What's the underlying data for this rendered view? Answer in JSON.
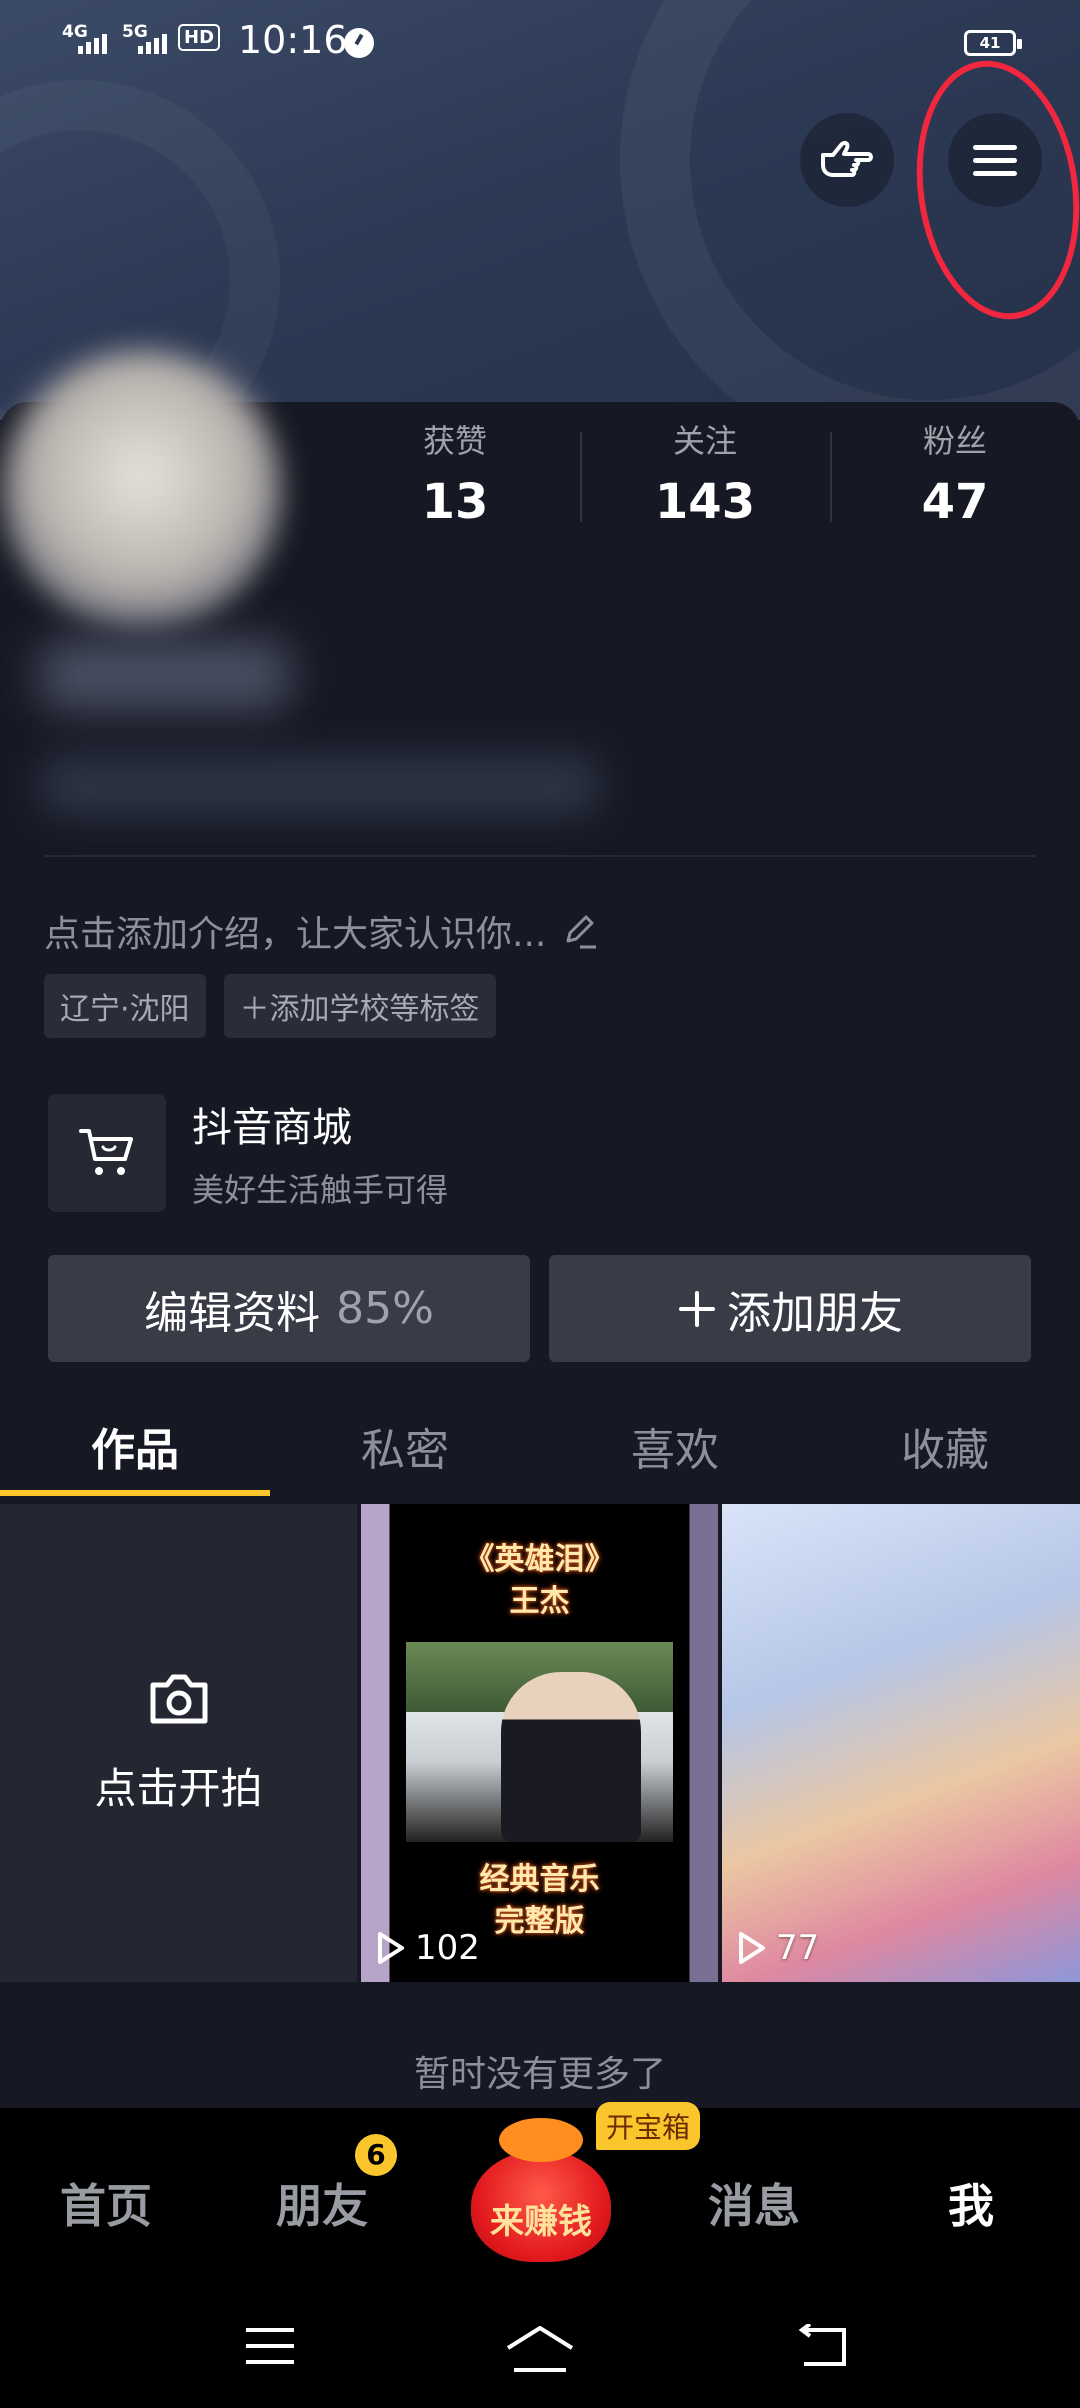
{
  "status_bar": {
    "signal1": "4G",
    "signal2": "5G",
    "hd": "HD",
    "time": "10:16",
    "battery": "41"
  },
  "profile": {
    "stats": [
      {
        "label": "获赞",
        "value": "13"
      },
      {
        "label": "关注",
        "value": "143"
      },
      {
        "label": "粉丝",
        "value": "47"
      }
    ],
    "intro": "点击添加介绍，让大家认识你...",
    "tags": [
      "辽宁·沈阳",
      "＋添加学校等标签"
    ]
  },
  "shop": {
    "title": "抖音商城",
    "subtitle": "美好生活触手可得"
  },
  "actions": {
    "edit_label": "编辑资料",
    "edit_percent": "85%",
    "add_friend_label": "添加朋友"
  },
  "tabs": [
    "作品",
    "私密",
    "喜欢",
    "收藏"
  ],
  "grid": {
    "shoot_label": "点击开拍",
    "videos": [
      {
        "title1": "《英雄泪》",
        "title2": "王杰",
        "caption1": "经典音乐",
        "caption2": "完整版",
        "plays": "102"
      },
      {
        "plays": "77"
      }
    ]
  },
  "no_more": "暂时没有更多了",
  "nav": {
    "home": "首页",
    "friends": "朋友",
    "friends_badge": "6",
    "earn": "来赚钱",
    "treasure": "开宝箱",
    "messages": "消息",
    "me": "我"
  },
  "colors": {
    "accent": "#fac62c",
    "background": "#161823",
    "highlight_ring": "#f0273e"
  }
}
